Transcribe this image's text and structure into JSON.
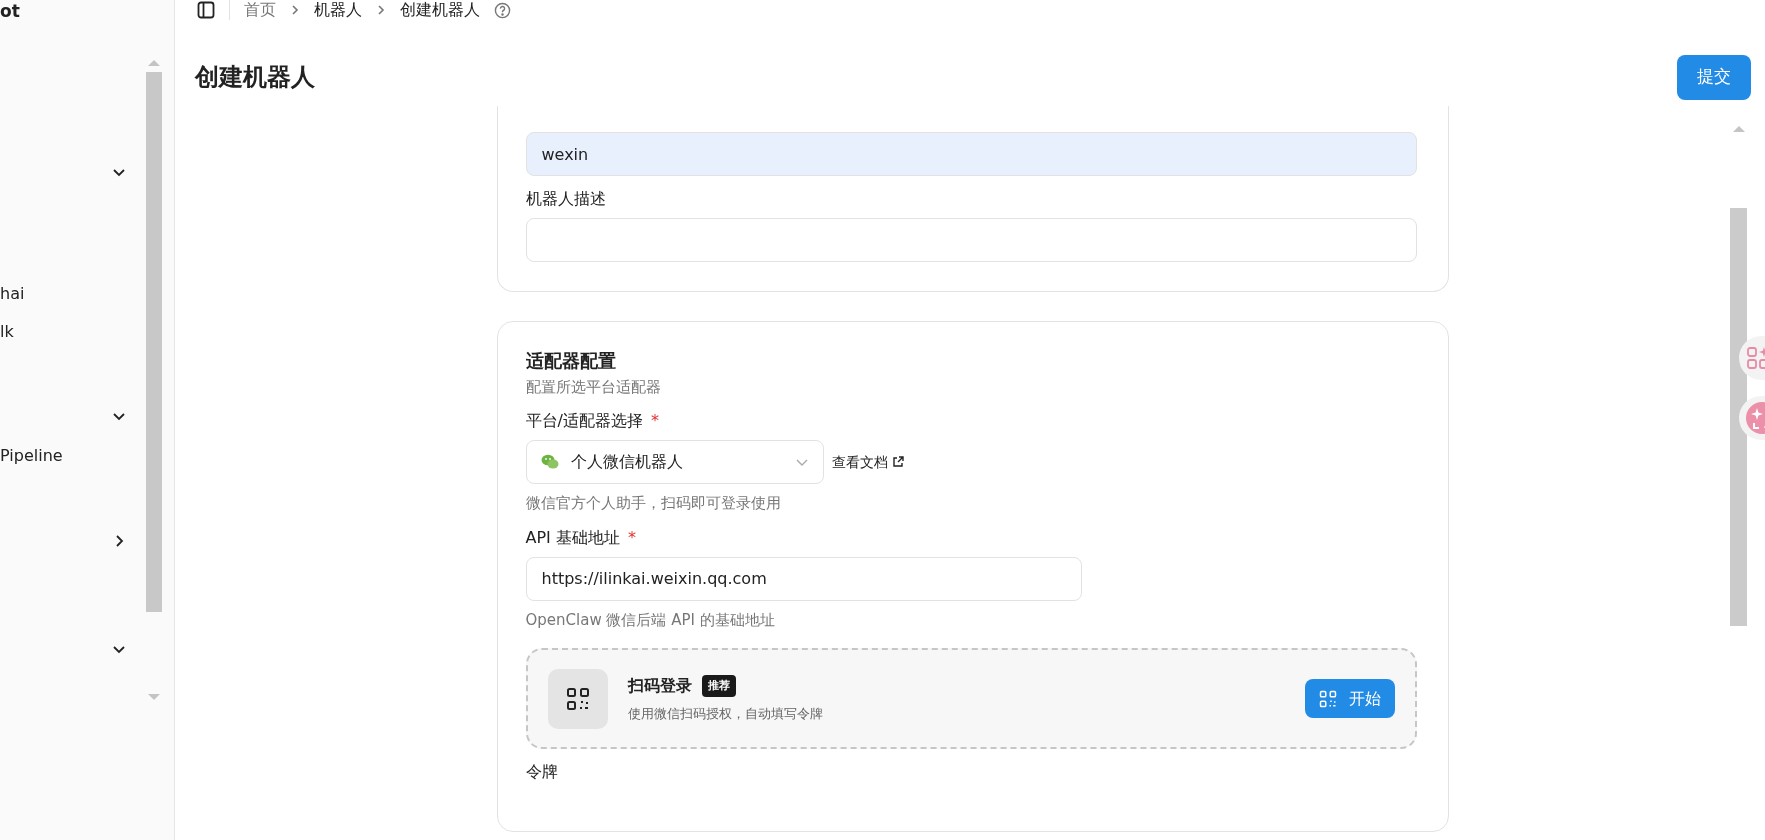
{
  "sidebar": {
    "brand": "ot",
    "items": [
      {
        "kind": "group",
        "expanded": true
      },
      {
        "kind": "link",
        "label": "hai"
      },
      {
        "kind": "link",
        "label": "lk"
      },
      {
        "kind": "group",
        "expanded": true
      },
      {
        "kind": "link",
        "label": "Pipeline"
      },
      {
        "kind": "group",
        "expanded": false
      },
      {
        "kind": "group",
        "expanded": true
      }
    ]
  },
  "breadcrumbs": [
    {
      "label": "首页",
      "muted": true
    },
    {
      "label": "机器人",
      "muted": false
    },
    {
      "label": "创建机器人",
      "muted": false
    }
  ],
  "page": {
    "title": "创建机器人",
    "submit": "提交"
  },
  "basic": {
    "fields": [
      {
        "value": "wexin",
        "autofilled": true
      },
      {
        "label": "机器人描述",
        "autofilled": false
      }
    ]
  },
  "adapter": {
    "title": "适配器配置",
    "subtitle": "配置所选平台适配器",
    "platform": {
      "label": "平台/适配器选择",
      "required_mark": "*",
      "value": "个人微信机器人",
      "docs_link": "查看文档",
      "help": "微信官方个人助手，扫码即可登录使用"
    },
    "api": {
      "label": "API 基础地址",
      "required_mark": "*",
      "value": "https://ilinkai.weixin.qq.com",
      "help": "OpenClaw 微信后端 API 的基础地址"
    },
    "scan": {
      "title": "扫码登录",
      "badge": "推荐",
      "description": "使用微信扫码授权，自动填写令牌",
      "button": "开始"
    },
    "token_label": "令牌"
  }
}
